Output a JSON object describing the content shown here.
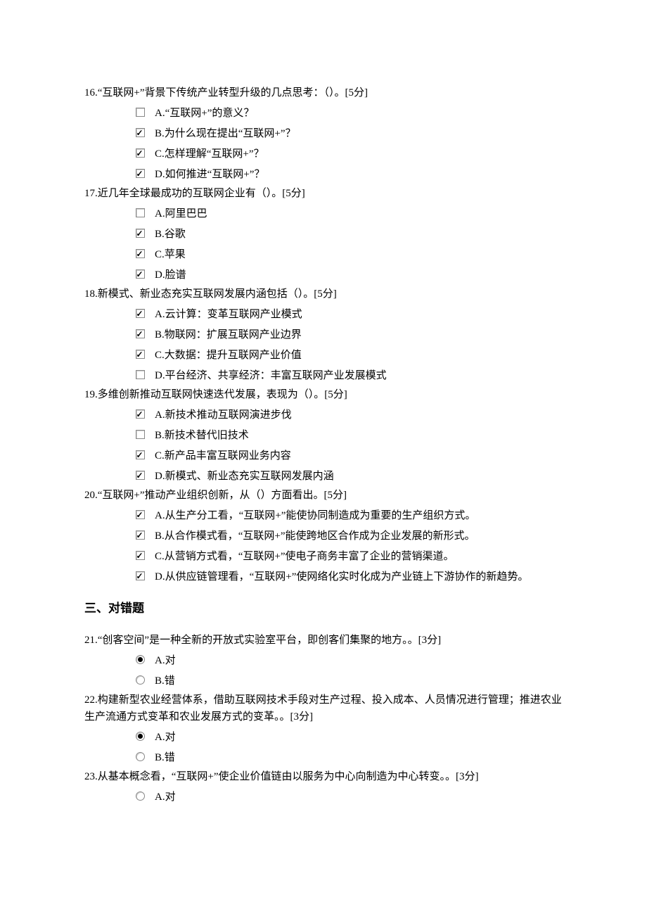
{
  "section_heading": "三、对错题",
  "questions": [
    {
      "number": "16",
      "text": "“互联网+”背景下传统产业转型升级的几点思考：（）。[5分]",
      "type": "checkbox",
      "options": [
        {
          "label": "A.“互联网+”的意义？",
          "checked": false
        },
        {
          "label": "B.为什么现在提出“互联网+”？",
          "checked": true
        },
        {
          "label": "C.怎样理解“互联网+”？",
          "checked": true
        },
        {
          "label": "D.如何推进“互联网+”？",
          "checked": true
        }
      ]
    },
    {
      "number": "17",
      "text": "近几年全球最成功的互联网企业有（）。[5分]",
      "type": "checkbox",
      "options": [
        {
          "label": "A.阿里巴巴",
          "checked": false
        },
        {
          "label": "B.谷歌",
          "checked": true
        },
        {
          "label": "C.苹果",
          "checked": true
        },
        {
          "label": "D.脸谱",
          "checked": true
        }
      ]
    },
    {
      "number": "18",
      "text": "新模式、新业态充实互联网发展内涵包括（）。[5分]",
      "type": "checkbox",
      "options": [
        {
          "label": "A.云计算：变革互联网产业模式",
          "checked": true
        },
        {
          "label": "B.物联网：扩展互联网产业边界",
          "checked": true
        },
        {
          "label": "C.大数据：提升互联网产业价值",
          "checked": true
        },
        {
          "label": "D.平台经济、共享经济：丰富互联网产业发展模式",
          "checked": false
        }
      ]
    },
    {
      "number": "19",
      "text": "多维创新推动互联网快速迭代发展，表现为（）。[5分]",
      "type": "checkbox",
      "options": [
        {
          "label": "A.新技术推动互联网演进步伐",
          "checked": true
        },
        {
          "label": "B.新技术替代旧技术",
          "checked": false
        },
        {
          "label": "C.新产品丰富互联网业务内容",
          "checked": true
        },
        {
          "label": "D.新模式、新业态充实互联网发展内涵",
          "checked": true
        }
      ]
    },
    {
      "number": "20",
      "text": "“互联网+”推动产业组织创新，从（）方面看出。[5分]",
      "type": "checkbox",
      "options": [
        {
          "label": "A.从生产分工看，“互联网+”能使协同制造成为重要的生产组织方式。",
          "checked": true
        },
        {
          "label": "B.从合作模式看，“互联网+”能使跨地区合作成为企业发展的新形式。",
          "checked": true
        },
        {
          "label": "C.从营销方式看，“互联网+”使电子商务丰富了企业的营销渠道。",
          "checked": true
        },
        {
          "label": "D.从供应链管理看，“互联网+”使网络化实时化成为产业链上下游协作的新趋势。",
          "checked": true
        }
      ]
    },
    {
      "section": true
    },
    {
      "number": "21",
      "text": "“创客空间”是一种全新的开放式实验室平台，即创客们集聚的地方。。[3分]",
      "type": "radio",
      "options": [
        {
          "label": "A.对",
          "checked": true
        },
        {
          "label": "B.错",
          "checked": false
        }
      ]
    },
    {
      "number": "22",
      "text": "构建新型农业经营体系，借助互联网技术手段对生产过程、投入成本、人员情况进行管理；推进农业生产流通方式变革和农业发展方式的变革。。[3分]",
      "type": "radio",
      "options": [
        {
          "label": "A.对",
          "checked": true
        },
        {
          "label": "B.错",
          "checked": false
        }
      ]
    },
    {
      "number": "23",
      "text": "从基本概念看，“互联网+”使企业价值链由以服务为中心向制造为中心转变。。[3分]",
      "type": "radio",
      "options": [
        {
          "label": "A.对",
          "checked": false
        }
      ]
    }
  ]
}
